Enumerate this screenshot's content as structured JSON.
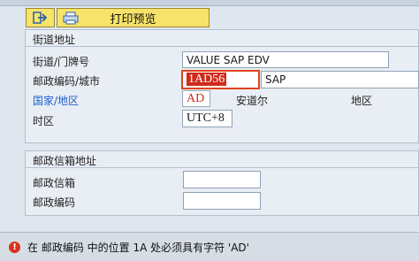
{
  "toolbar": {
    "print_preview_label": "打印预览",
    "icons": {
      "exit": "exit-arrow-icon",
      "print": "printer-icon"
    }
  },
  "street_section": {
    "title": "街道地址",
    "street_label": "街道/门牌号",
    "street_value": "VALUE SAP EDV",
    "postal_city_label": "邮政编码/城市",
    "postal_value": "1AD56",
    "city_value": "SAP",
    "country_region_label": "国家/地区",
    "country_value": "AD",
    "country_name": "安道尔",
    "region_label": "地区",
    "timezone_label": "时区",
    "timezone_value": "UTC+8"
  },
  "pobox_section": {
    "title": "邮政信箱地址",
    "pobox_label": "邮政信箱",
    "pobox_value": "",
    "pobox_postal_label": "邮政编码",
    "pobox_postal_value": ""
  },
  "status_bar": {
    "message": "在 邮政编码 中的位置 1A 处必须具有字符 'AD'",
    "type": "error",
    "colors": {
      "error": "#d8321d"
    }
  }
}
